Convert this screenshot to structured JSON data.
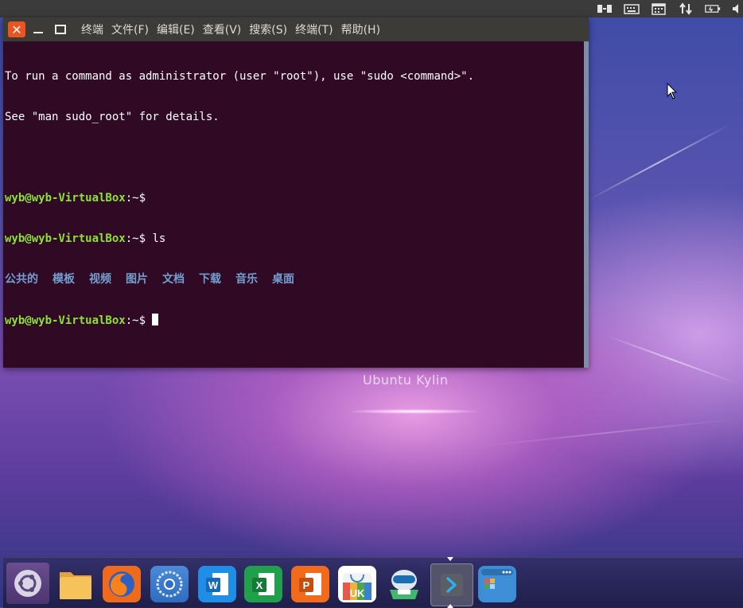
{
  "desktop": {
    "brand_text": "Ubuntu Kylin"
  },
  "tray": {
    "icons": [
      "network-icon",
      "keyboard-icon",
      "calendar-icon",
      "transfer-icon",
      "battery-icon",
      "volume-icon"
    ]
  },
  "terminal": {
    "menu": [
      "终端",
      "文件(F)",
      "编辑(E)",
      "查看(V)",
      "搜索(S)",
      "终端(T)",
      "帮助(H)"
    ],
    "lines": {
      "info1": "To run a command as administrator (user \"root\"), use \"sudo <command>\".",
      "info2": "See \"man sudo_root\" for details.",
      "prompt": "wyb@wyb-VirtualBox",
      "suffix": ":~$",
      "command": " ls"
    },
    "dirs": [
      "公共的",
      "模板",
      "视频",
      "图片",
      "文档",
      "下载",
      "音乐",
      "桌面"
    ]
  },
  "dock": {
    "items": [
      "dash-home",
      "files",
      "firefox",
      "chromium",
      "wps-writer",
      "wps-spreadsheets",
      "wps-presentation",
      "software-center",
      "kylin-assistant",
      "terminal",
      "app-launcher"
    ],
    "uk_label": "UK",
    "w_label": "W",
    "x_label": "X",
    "p_label": "P"
  },
  "colors": {
    "accent": "#e95420",
    "terminal_bg": "#300a24",
    "prompt": "#8ae234",
    "dir": "#729fcf"
  }
}
